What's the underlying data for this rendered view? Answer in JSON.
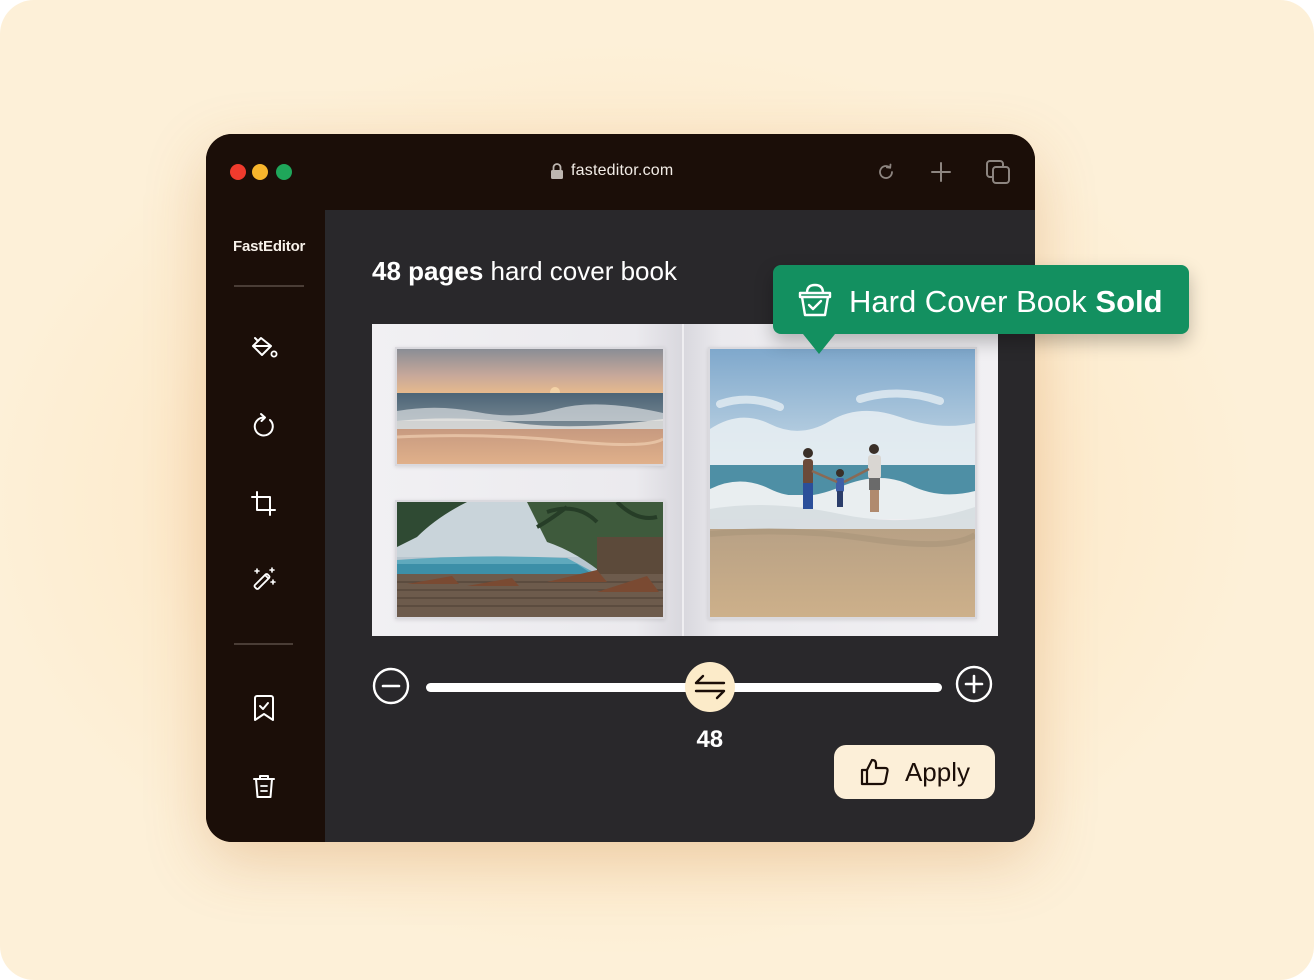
{
  "browser": {
    "url": "fasteditor.com",
    "icons": [
      "lock-icon",
      "refresh-icon",
      "new-tab-icon",
      "tabs-icon"
    ]
  },
  "sidebar": {
    "brand": "FastEditor",
    "tools": [
      {
        "name": "fill-tool",
        "icon": "paint-bucket-icon"
      },
      {
        "name": "rotate-tool",
        "icon": "rotate-icon"
      },
      {
        "name": "crop-tool",
        "icon": "crop-icon"
      },
      {
        "name": "magic-tool",
        "icon": "magic-wand-icon"
      },
      {
        "name": "save-tool",
        "icon": "bookmark-check-icon"
      },
      {
        "name": "delete-tool",
        "icon": "trash-icon"
      }
    ]
  },
  "editor": {
    "heading_bold": "48 pages",
    "heading_rest": " hard cover book",
    "photos": [
      "sunset-beach",
      "resort-pool",
      "family-beach"
    ],
    "slider": {
      "value": "48",
      "fraction": 0.55
    },
    "apply_label": "Apply"
  },
  "toast": {
    "text": "Hard Cover Book ",
    "text_bold": "Sold",
    "icon": "basket-check-icon"
  },
  "colors": {
    "window_bg": "#1b0e08",
    "panel_bg": "#29282b",
    "accent_green": "#139060",
    "knob": "#fcebc9",
    "button_bg": "#fcefd8"
  }
}
